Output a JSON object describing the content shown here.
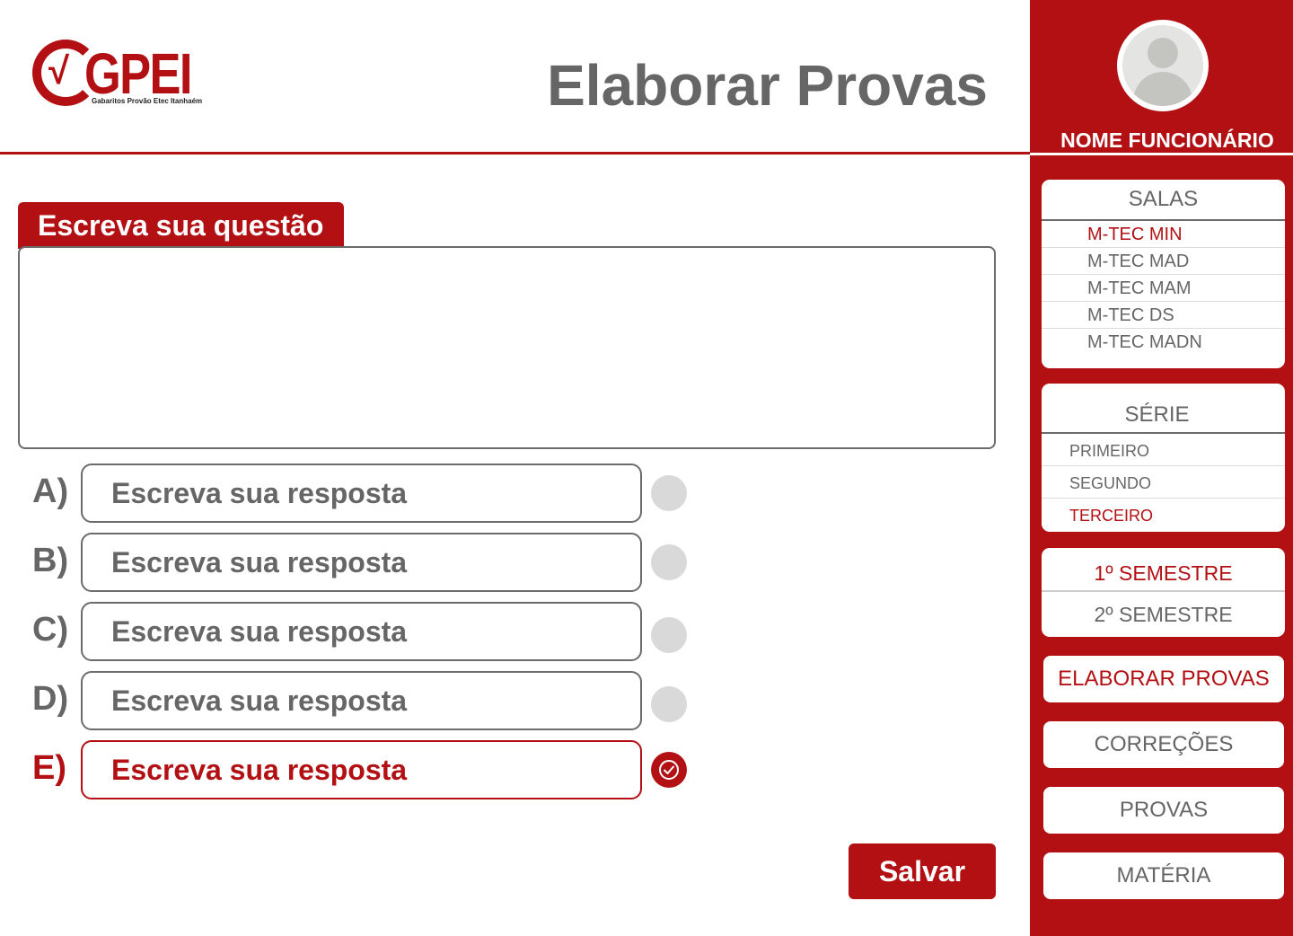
{
  "app": {
    "logo_text": "GPEI",
    "logo_subtitle": "Gabaritos Provão Etec Itanhaém",
    "logo_check": "√"
  },
  "page_title": "Elaborar Provas",
  "question": {
    "tab_label": "Escreva sua questão",
    "value": ""
  },
  "answers": [
    {
      "letter": "A)",
      "placeholder": "Escreva sua resposta",
      "value": "",
      "selected": false
    },
    {
      "letter": "B)",
      "placeholder": "Escreva sua resposta",
      "value": "",
      "selected": false
    },
    {
      "letter": "C)",
      "placeholder": "Escreva sua resposta",
      "value": "",
      "selected": false
    },
    {
      "letter": "D)",
      "placeholder": "Escreva sua resposta",
      "value": "",
      "selected": false
    },
    {
      "letter": "E)",
      "placeholder": "Escreva sua resposta",
      "value": "",
      "selected": true
    }
  ],
  "save_label": "Salvar",
  "sidebar": {
    "user_name": "NOME FUNCIONÁRIO",
    "salas": {
      "title": "SALAS",
      "items": [
        "M-TEC MIN",
        "M-TEC MAD",
        "M-TEC MAM",
        "M-TEC DS",
        "M-TEC MADN"
      ],
      "active": "M-TEC MIN"
    },
    "serie": {
      "title": "SÉRIE",
      "items": [
        "PRIMEIRO",
        "SEGUNDO",
        "TERCEIRO"
      ],
      "active": "TERCEIRO"
    },
    "semestre": {
      "items": [
        "1º SEMESTRE",
        "2º SEMESTRE"
      ],
      "active": "1º SEMESTRE"
    },
    "nav": {
      "elaborar": "ELABORAR PROVAS",
      "correcoes": "CORREÇÕES",
      "provas": "PROVAS",
      "materia": "MATÉRIA",
      "active": "ELABORAR PROVAS"
    }
  },
  "colors": {
    "accent": "#b31014",
    "text": "#666666",
    "radio_off": "#d9d9d9",
    "background": "#ffffff"
  },
  "icons": {
    "selected_radio": "check-circle-icon",
    "avatar": "user-avatar-icon"
  }
}
